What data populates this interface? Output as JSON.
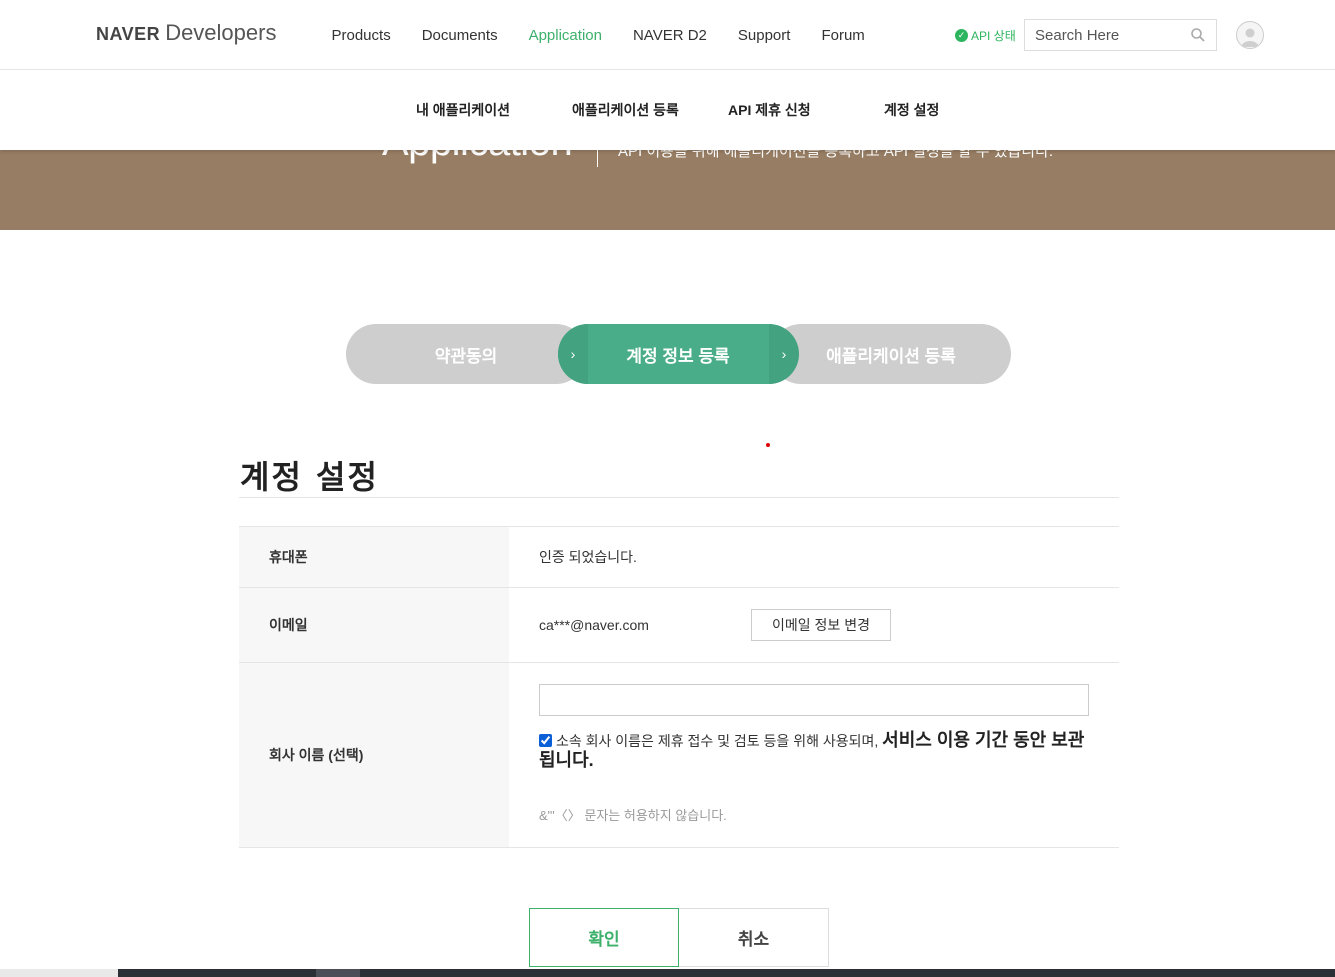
{
  "header": {
    "logo_naver": "NAVER",
    "logo_developers": "Developers",
    "nav": [
      "Products",
      "Documents",
      "Application",
      "NAVER D2",
      "Support",
      "Forum"
    ],
    "active_nav": "Application",
    "api_status": "API 상태",
    "search_placeholder": "Search Here",
    "accent_color": "#3db06b"
  },
  "subnav": {
    "items": [
      "내 애플리케이션",
      "애플리케이션 등록",
      "API 제휴 신청",
      "계정 설정"
    ]
  },
  "banner": {
    "title": "Application",
    "description": "API 이용을 위해 애플리케이션을 등록하고 API 설정을 할 수 있습니다.",
    "color": "#977d63"
  },
  "steps": {
    "items": [
      "약관동의",
      "계정 정보 등록",
      "애플리케이션 등록"
    ],
    "active": "계정 정보 등록",
    "active_color": "#4aad8a",
    "inactive_color": "#cecece"
  },
  "form": {
    "title": "계정 설정",
    "phone_label": "휴대폰",
    "phone_value": "인증 되었습니다.",
    "email_label": "이메일",
    "email_value": "ca***@naver.com",
    "email_change_button": "이메일 정보 변경",
    "company_label": "회사 이름 (선택)",
    "company_value": "",
    "agree_text": "소속 회사 이름은 제휴 접수 및 검토 등을 위해 사용되며, ",
    "agree_strong": "서비스 이용 기간 동안 보관됩니다.",
    "agree_checked": true,
    "hint": "&\"'〈〉 문자는 허용하지 않습니다."
  },
  "buttons": {
    "confirm": "확인",
    "cancel": "취소"
  }
}
